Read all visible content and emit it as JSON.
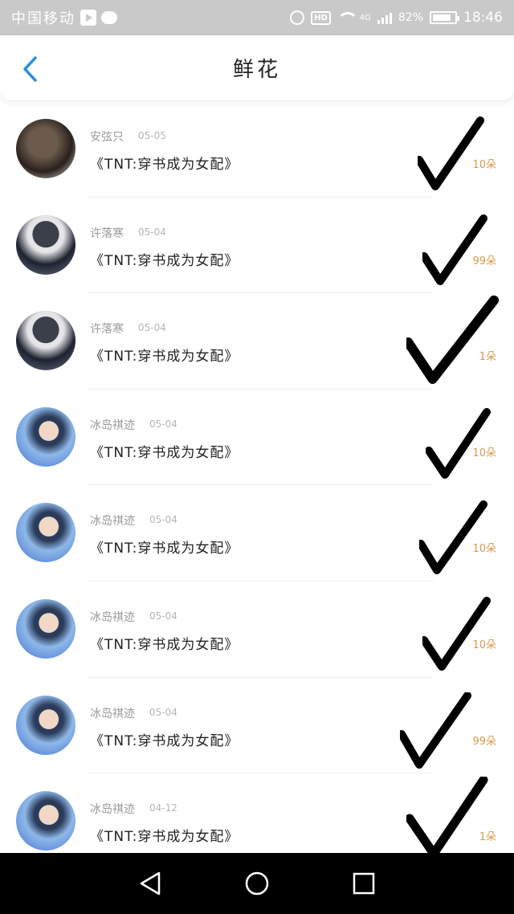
{
  "status_bar": {
    "carrier": "中国移动",
    "network": "4G",
    "battery": "82%",
    "time": "18:46"
  },
  "header": {
    "title": "鲜花"
  },
  "items": [
    {
      "user": "安弦只",
      "date": "05-05",
      "book": "《TNT:穿书成为女配》",
      "count": "10朵",
      "avatar": "curly-hair"
    },
    {
      "user": "许落寒",
      "date": "05-04",
      "book": "《TNT:穿书成为女配》",
      "count": "99朵",
      "avatar": "dark-jacket"
    },
    {
      "user": "许落寒",
      "date": "05-04",
      "book": "《TNT:穿书成为女配》",
      "count": "1朵",
      "avatar": "dark-jacket"
    },
    {
      "user": "冰岛祺迹",
      "date": "05-04",
      "book": "《TNT:穿书成为女配》",
      "count": "10朵",
      "avatar": "blue-background"
    },
    {
      "user": "冰岛祺迹",
      "date": "05-04",
      "book": "《TNT:穿书成为女配》",
      "count": "10朵",
      "avatar": "blue-background"
    },
    {
      "user": "冰岛祺迹",
      "date": "05-04",
      "book": "《TNT:穿书成为女配》",
      "count": "10朵",
      "avatar": "blue-background"
    },
    {
      "user": "冰岛祺迹",
      "date": "05-04",
      "book": "《TNT:穿书成为女配》",
      "count": "99朵",
      "avatar": "blue-background"
    },
    {
      "user": "冰岛祺迹",
      "date": "04-12",
      "book": "《TNT:穿书成为女配》",
      "count": "1朵",
      "avatar": "blue-background"
    }
  ],
  "colors": {
    "accent": "#2f8ee0",
    "count": "#d69a4a",
    "status_bar": "#c9c9c9"
  }
}
